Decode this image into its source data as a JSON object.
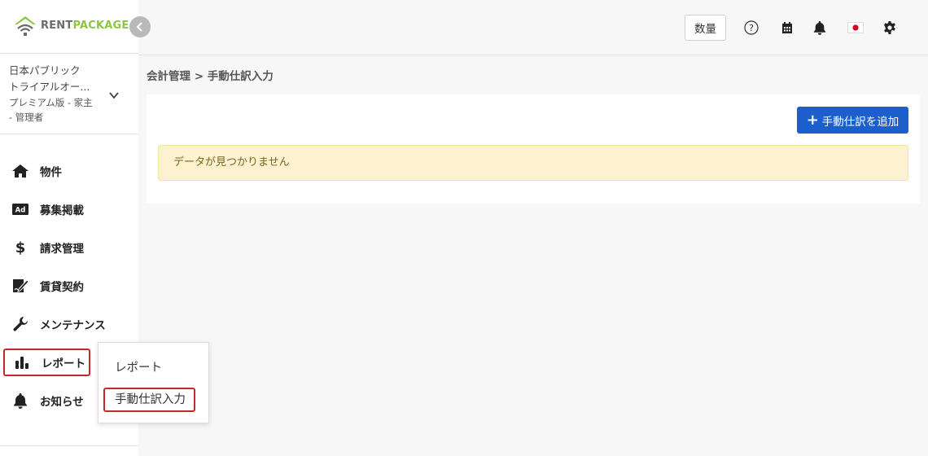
{
  "brand": {
    "rent": "RENT",
    "package": "PACKAGE",
    "accent": "#8cc63f"
  },
  "account": {
    "company": "日本パブリック",
    "name": "トライアルオー...",
    "plan": "プレミアム版 - 家主",
    "role": "- 管理者"
  },
  "nav": {
    "items": [
      {
        "label": "物件",
        "icon": "home-icon"
      },
      {
        "label": "募集掲載",
        "icon": "ad-icon"
      },
      {
        "label": "請求管理",
        "icon": "dollar-icon"
      },
      {
        "label": "賃貸契約",
        "icon": "contract-sign-icon"
      },
      {
        "label": "メンテナンス",
        "icon": "wrench-icon"
      },
      {
        "label": "レポート",
        "icon": "bar-chart-icon"
      },
      {
        "label": "お知らせ",
        "icon": "bell-icon"
      }
    ],
    "active_index": 5
  },
  "flyout": {
    "items": [
      {
        "label": "レポート"
      },
      {
        "label": "手動仕訳入力"
      }
    ]
  },
  "header": {
    "qty_label": "数量",
    "icons": [
      "help-icon",
      "calendar-icon",
      "bell-icon",
      "japan-flag-icon",
      "gear-icon"
    ]
  },
  "breadcrumb": "会計管理 > 手動仕訳入力",
  "main": {
    "add_button_label": "手動仕訳を追加",
    "empty_message": "データが見つかりません"
  },
  "colors": {
    "primary": "#1a5fcc",
    "highlight": "#c9252c",
    "alert_bg": "#fdf2cf"
  }
}
